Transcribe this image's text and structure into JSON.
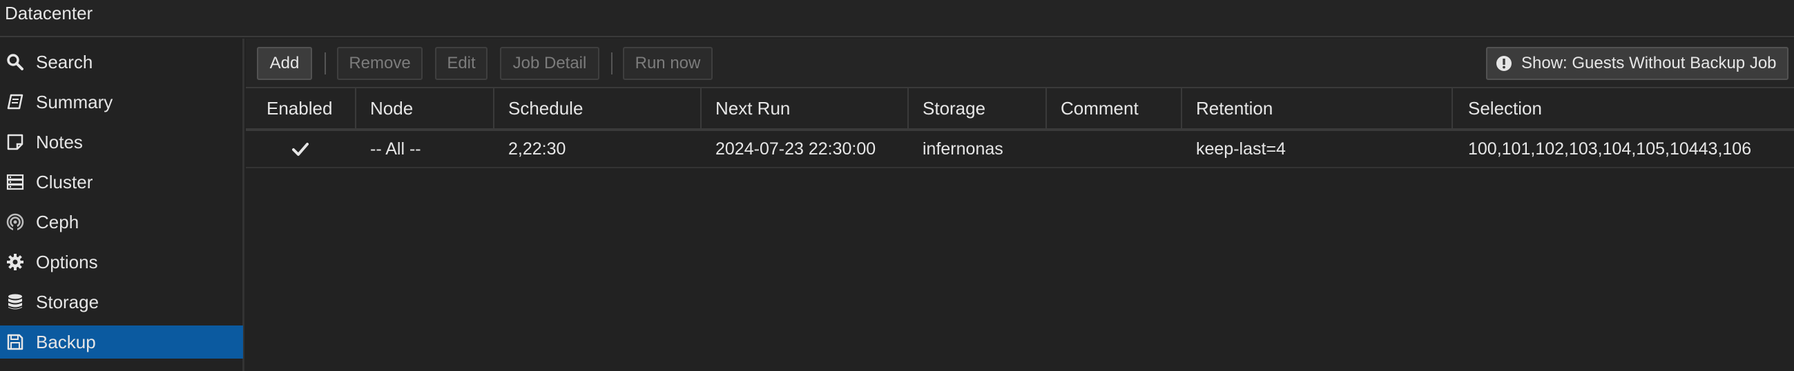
{
  "titlebar": {
    "title": "Datacenter"
  },
  "sidebar": {
    "items": [
      {
        "label": "Search",
        "icon": "search-icon"
      },
      {
        "label": "Summary",
        "icon": "book-icon"
      },
      {
        "label": "Notes",
        "icon": "sticky-note-icon"
      },
      {
        "label": "Cluster",
        "icon": "server-icon"
      },
      {
        "label": "Ceph",
        "icon": "ceph-icon"
      },
      {
        "label": "Options",
        "icon": "gear-icon"
      },
      {
        "label": "Storage",
        "icon": "database-icon"
      },
      {
        "label": "Backup",
        "icon": "floppy-disk-icon",
        "active": true
      }
    ],
    "active_color": "#0b5aa0"
  },
  "toolbar": {
    "add": "Add",
    "remove": "Remove",
    "edit": "Edit",
    "job_detail": "Job Detail",
    "run_now": "Run now",
    "show_guests": "Show: Guests Without Backup Job"
  },
  "table": {
    "columns": [
      "Enabled",
      "Node",
      "Schedule",
      "Next Run",
      "Storage",
      "Comment",
      "Retention",
      "Selection"
    ],
    "rows": [
      {
        "enabled": true,
        "node": "-- All --",
        "schedule": "2,22:30",
        "next_run": "2024-07-23 22:30:00",
        "storage": "infernonas",
        "comment": "",
        "retention": "keep-last=4",
        "selection": "100,101,102,103,104,105,10443,106"
      }
    ]
  }
}
